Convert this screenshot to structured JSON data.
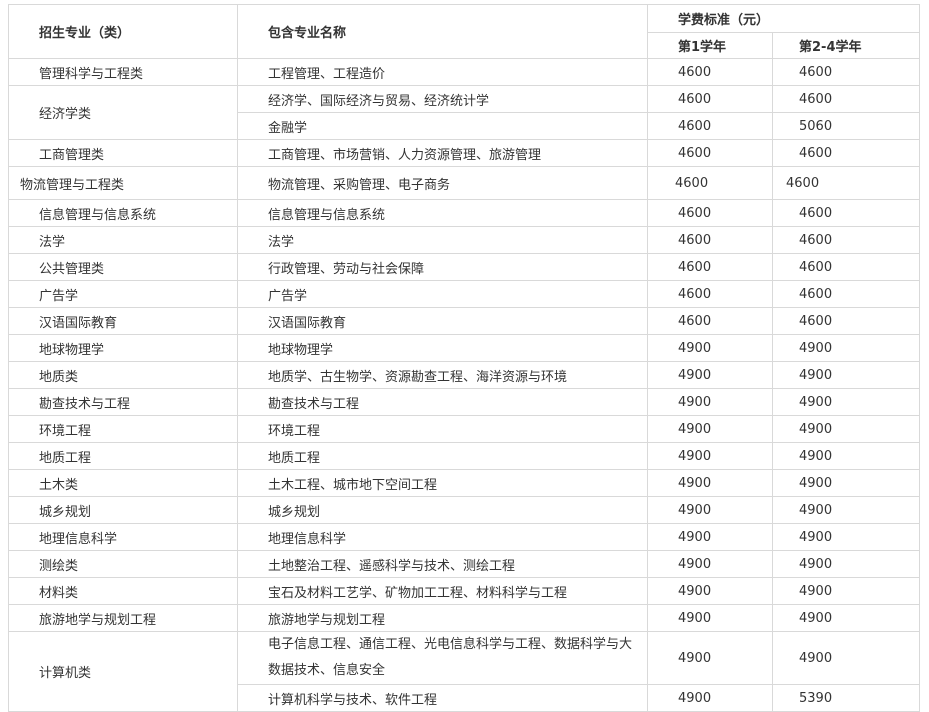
{
  "header": {
    "col_major": "招生专业（类）",
    "col_sub": "包含专业名称",
    "col_fee": "学费标准（元）",
    "col_year1": "第1学年",
    "col_year24": "第2-4学年"
  },
  "rows": [
    {
      "major": "管理科学与工程类",
      "subs": [
        {
          "name": "工程管理、工程造价",
          "y1": "4600",
          "y24": "4600"
        }
      ]
    },
    {
      "major": "经济学类",
      "subs": [
        {
          "name": "经济学、国际经济与贸易、经济统计学",
          "y1": "4600",
          "y24": "4600"
        },
        {
          "name": "金融学",
          "y1": "4600",
          "y24": "5060"
        }
      ]
    },
    {
      "major": "工商管理类",
      "subs": [
        {
          "name": "工商管理、市场营销、人力资源管理、旅游管理",
          "y1": "4600",
          "y24": "4600"
        }
      ]
    },
    {
      "major": "物流管理与工程类",
      "subs": [
        {
          "name": "物流管理、采购管理、电子商务",
          "y1": "4600",
          "y24": "4600"
        }
      ]
    },
    {
      "major": "信息管理与信息系统",
      "subs": [
        {
          "name": "信息管理与信息系统",
          "y1": "4600",
          "y24": "4600"
        }
      ]
    },
    {
      "major": "法学",
      "subs": [
        {
          "name": "法学",
          "y1": "4600",
          "y24": "4600"
        }
      ]
    },
    {
      "major": "公共管理类",
      "subs": [
        {
          "name": "行政管理、劳动与社会保障",
          "y1": "4600",
          "y24": "4600"
        }
      ]
    },
    {
      "major": "广告学",
      "subs": [
        {
          "name": "广告学",
          "y1": "4600",
          "y24": "4600"
        }
      ]
    },
    {
      "major": "汉语国际教育",
      "subs": [
        {
          "name": "汉语国际教育",
          "y1": "4600",
          "y24": "4600"
        }
      ]
    },
    {
      "major": "地球物理学",
      "subs": [
        {
          "name": "地球物理学",
          "y1": "4900",
          "y24": "4900"
        }
      ]
    },
    {
      "major": "地质类",
      "subs": [
        {
          "name": "地质学、古生物学、资源勘查工程、海洋资源与环境",
          "y1": "4900",
          "y24": "4900"
        }
      ]
    },
    {
      "major": "勘查技术与工程",
      "subs": [
        {
          "name": "勘查技术与工程",
          "y1": "4900",
          "y24": "4900"
        }
      ]
    },
    {
      "major": "环境工程",
      "subs": [
        {
          "name": "环境工程",
          "y1": "4900",
          "y24": "4900"
        }
      ]
    },
    {
      "major": "地质工程",
      "subs": [
        {
          "name": "地质工程",
          "y1": "4900",
          "y24": "4900"
        }
      ]
    },
    {
      "major": "土木类",
      "subs": [
        {
          "name": "土木工程、城市地下空间工程",
          "y1": "4900",
          "y24": "4900"
        }
      ]
    },
    {
      "major": "城乡规划",
      "subs": [
        {
          "name": "城乡规划",
          "y1": "4900",
          "y24": "4900"
        }
      ]
    },
    {
      "major": "地理信息科学",
      "subs": [
        {
          "name": "地理信息科学",
          "y1": "4900",
          "y24": "4900"
        }
      ]
    },
    {
      "major": "测绘类",
      "subs": [
        {
          "name": "土地整治工程、遥感科学与技术、测绘工程",
          "y1": "4900",
          "y24": "4900"
        }
      ]
    },
    {
      "major": "材料类",
      "subs": [
        {
          "name": "宝石及材料工艺学、矿物加工工程、材料科学与工程",
          "y1": "4900",
          "y24": "4900"
        }
      ]
    },
    {
      "major": "旅游地学与规划工程",
      "subs": [
        {
          "name": "旅游地学与规划工程",
          "y1": "4900",
          "y24": "4900"
        }
      ]
    },
    {
      "major": "计算机类",
      "subs": [
        {
          "name": "电子信息工程、通信工程、光电信息科学与工程、数据科学与大数据技术、信息安全",
          "y1": "4900",
          "y24": "4900"
        },
        {
          "name": "计算机科学与技术、软件工程",
          "y1": "4900",
          "y24": "5390"
        }
      ]
    }
  ]
}
